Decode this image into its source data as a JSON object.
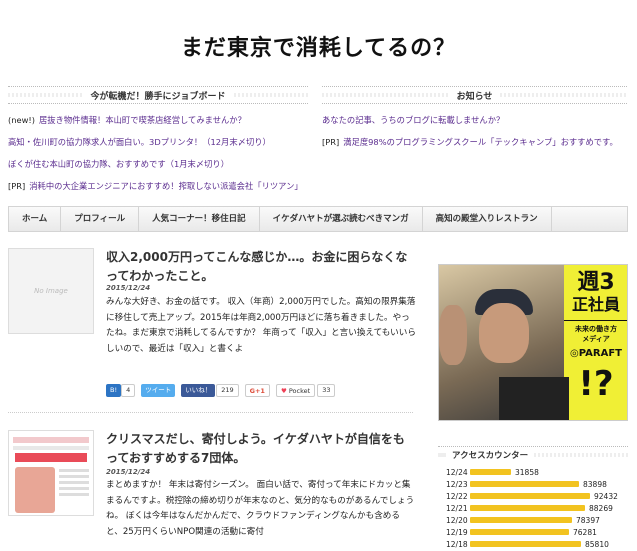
{
  "site": {
    "title": "まだ東京で消耗してるの？"
  },
  "boards": {
    "left": {
      "title": "今が転機だ！勝手にジョブボード",
      "links": [
        {
          "prefix": "(new!)",
          "text": "居抜き物件情報！本山町で喫茶店経営してみませんか？"
        },
        {
          "prefix": "",
          "text": "高知・佐川町の協力隊求人が面白い。3Dプリンタ！（12月末〆切り）"
        },
        {
          "prefix": "",
          "text": "ぼくが住む本山町の協力隊、おすすめです（1月末〆切り）"
        },
        {
          "prefix": "[PR]",
          "text": "消耗中の大企業エンジニアにおすすめ！搾取しない派遣会社「リツアン」"
        }
      ]
    },
    "right": {
      "title": "お知らせ",
      "links": [
        {
          "prefix": "",
          "text": "あなたの記事、うちのブログに転載しませんか？"
        },
        {
          "prefix": "[PR]",
          "text": "満足度98%のプログラミングスクール「テックキャンプ」おすすめです。"
        }
      ]
    }
  },
  "nav": {
    "items": [
      "ホーム",
      "プロフィール",
      "人気コーナー！移住日記",
      "イケダハヤトが選ぶ読むべきマンガ",
      "高知の殿堂入りレストラン"
    ]
  },
  "posts": [
    {
      "thumb_label": "No Image",
      "title": "収入2,000万円ってこんな感じか…。お金に困らなくなってわかったこと。",
      "date": "2015/12/24",
      "excerpt": "みんな大好き、お金の話です。 収入（年商）2,000万円でした。高知の限界集落に移住して売上アップ。2015年は年商2,000万円ほどに落ち着きました。やったね。まだ東京で消耗してるんですか？ 年商って「収入」と言い換えてもいいらしいので、最近は「収入」と書くよ",
      "share": {
        "hatena_label": "B!",
        "hatena_count": "4",
        "tweet_label": "ツイート",
        "fb_label": "いいね！",
        "fb_count": "219",
        "gplus_label": "G+1",
        "pocket_label": "Pocket",
        "pocket_count": "33"
      }
    },
    {
      "title": "クリスマスだし、寄付しよう。イケダハヤトが自信をもっておすすめする7団体。",
      "date": "2015/12/24",
      "excerpt": "まとめますか！ 年末は寄付シーズン。 面白い話で、寄付って年末にドカッと集まるんですよ。税控除の締め切りが年末なのと、気分的なものがあるんでしょうね。 ぼくは今年はなんだかんだで、クラウドファンディングなんかも含めると、25万円くらいNPO関連の活動に寄付"
    }
  ],
  "ad": {
    "line1": "週3",
    "line2": "正社員",
    "line3": "未来の働き方",
    "line4": "メディア",
    "line5": "◎PARAFT",
    "line6": "!?"
  },
  "counter": {
    "title": "アクセスカウンター",
    "rows": [
      {
        "date": "12/24",
        "value": "31858"
      },
      {
        "date": "12/23",
        "value": "83898"
      },
      {
        "date": "12/22",
        "value": "92432"
      },
      {
        "date": "12/21",
        "value": "88269"
      },
      {
        "date": "12/20",
        "value": "78397"
      },
      {
        "date": "12/19",
        "value": "76281"
      },
      {
        "date": "12/18",
        "value": "85810"
      }
    ],
    "bar_color": "#f2c320"
  },
  "colors": {
    "link": "#5b2d8f",
    "accent_yellow": "#f0ef35"
  }
}
